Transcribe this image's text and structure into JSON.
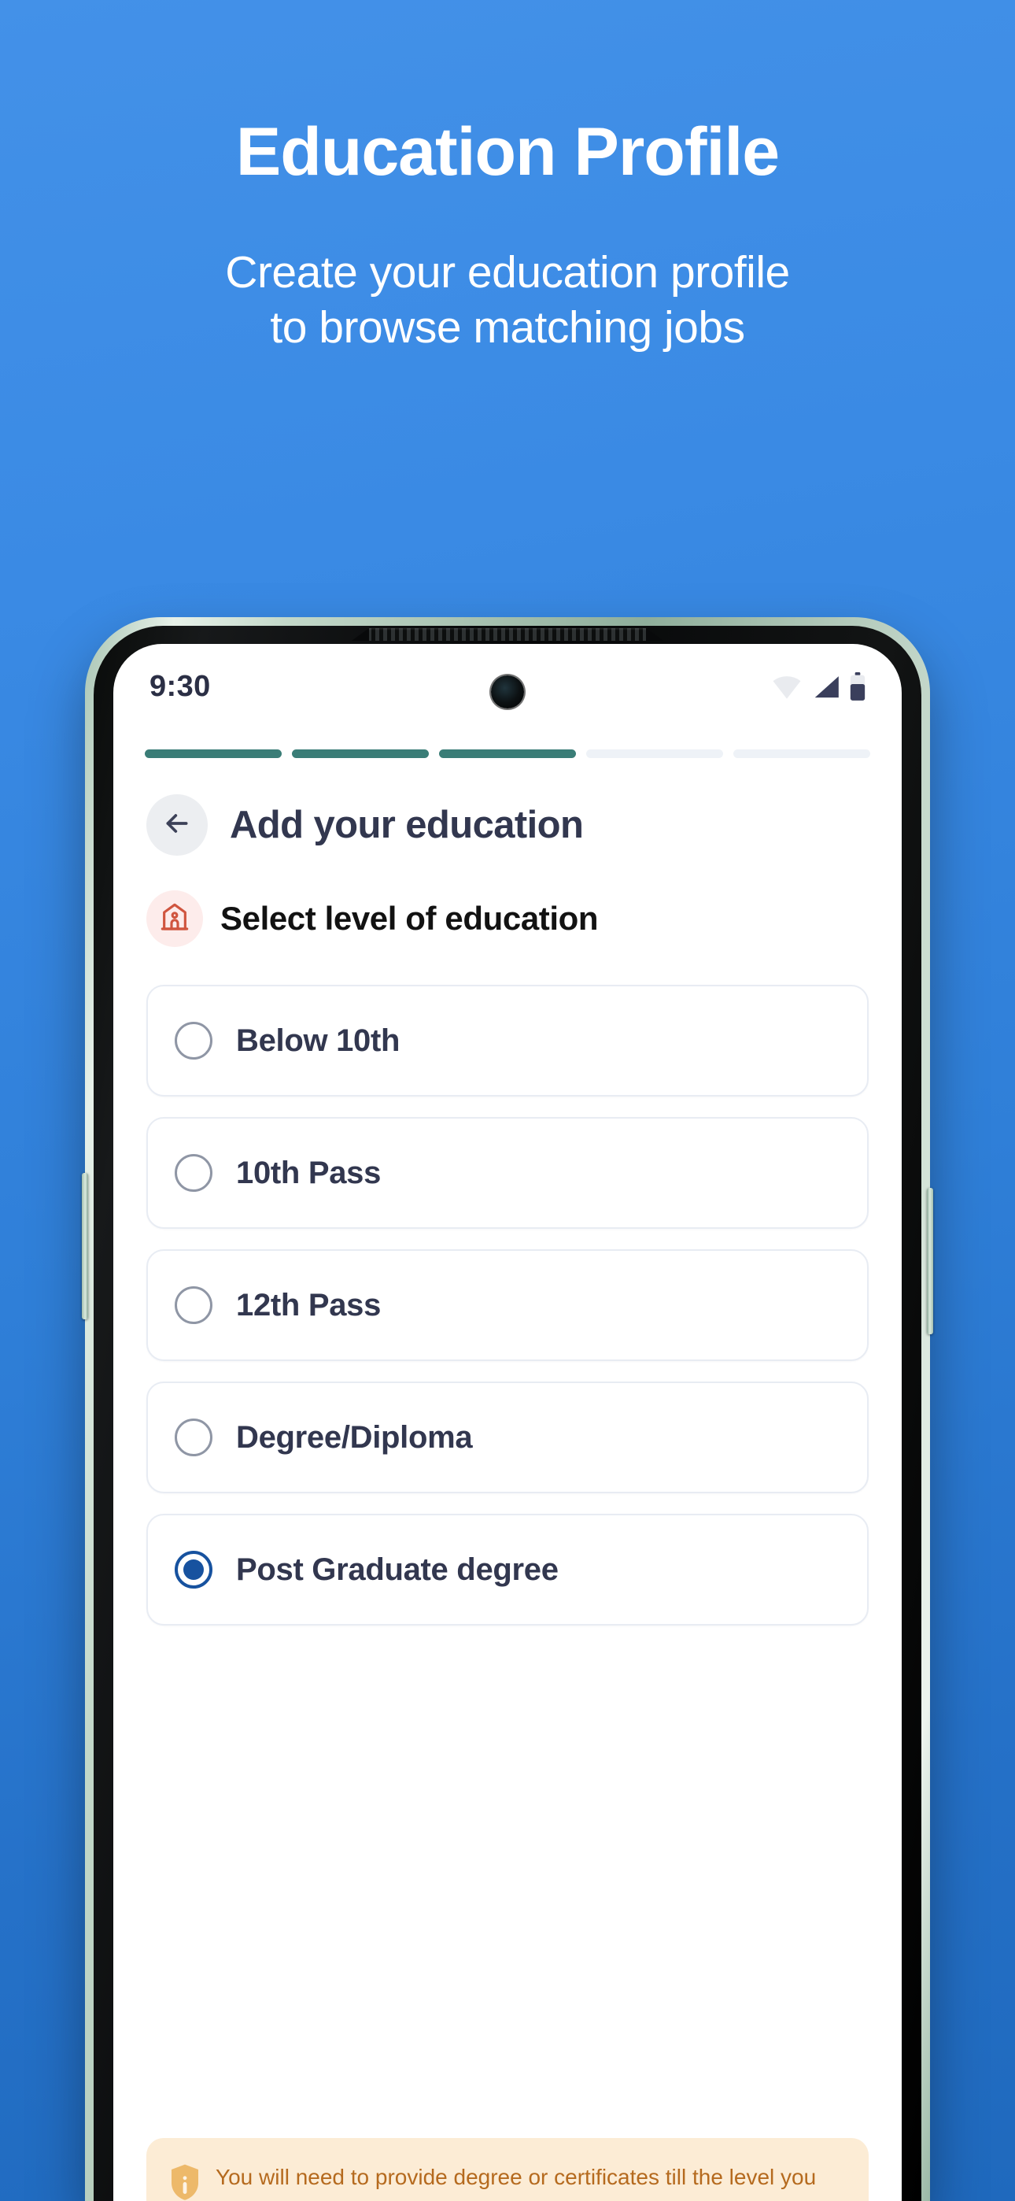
{
  "promo": {
    "title": "Education Profile",
    "subtitle_line1": "Create your education profile",
    "subtitle_line2": "to browse matching jobs"
  },
  "colors": {
    "background_top": "#4391e8",
    "background_bottom": "#1f69bd",
    "progress_active": "#3a7d77",
    "progress_inactive": "#eef2f7",
    "radio_selected": "#17529f",
    "section_icon": "#d0553f",
    "section_icon_bg": "#fdeceb",
    "banner_bg": "#fcecd5",
    "banner_text": "#b56a1e",
    "title_text": "#32374f"
  },
  "status_bar": {
    "time": "9:30",
    "icons": [
      "wifi-icon",
      "signal-icon",
      "battery-icon"
    ]
  },
  "progress": {
    "total_steps": 5,
    "completed_steps": 3,
    "segments": [
      true,
      true,
      true,
      false,
      false
    ]
  },
  "nav": {
    "back_icon": "back-arrow-icon",
    "title": "Add your education"
  },
  "section": {
    "icon": "school-icon",
    "label": "Select level of education"
  },
  "options": [
    {
      "label": "Below 10th",
      "selected": false
    },
    {
      "label": "10th Pass",
      "selected": false
    },
    {
      "label": "12th Pass",
      "selected": false
    },
    {
      "label": "Degree/Diploma",
      "selected": false
    },
    {
      "label": "Post Graduate degree",
      "selected": true
    }
  ],
  "info_banner": {
    "icon": "info-shield-icon",
    "text": "You will need to provide degree or certificates till the level you"
  }
}
